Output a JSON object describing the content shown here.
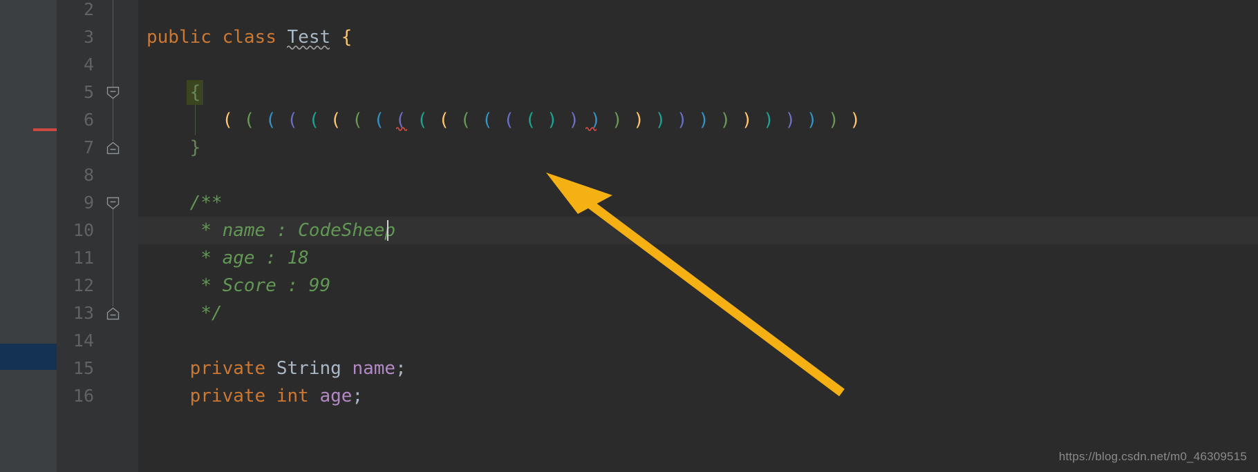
{
  "theme": {
    "editor_bg": "#2b2b2b",
    "gutter_bg": "#313335",
    "panel_bg": "#3c3f41",
    "caret_line_bg": "#323232",
    "line_number_color": "#606366",
    "keyword_color": "#cc7832",
    "comment_color": "#629755",
    "field_color": "#b389c5",
    "identifier_color": "#a9b7c6",
    "brace_yellow": "#ffc66d",
    "brace_green": "#6a8759",
    "error_underline_color": "#cc4a42",
    "warning_underline_color": "#9b9b9b",
    "brace_match_highlight": "#3b4620",
    "arrow_color": "#f5b014"
  },
  "gutter": {
    "line_numbers": [
      "2",
      "3",
      "4",
      "5",
      "6",
      "7",
      "8",
      "9",
      "10",
      "11",
      "12",
      "13",
      "14",
      "15",
      "16"
    ],
    "fold_markers": [
      {
        "line": "5",
        "type": "collapse-minus-icon"
      },
      {
        "line": "7",
        "type": "fold-end-icon"
      },
      {
        "line": "9",
        "type": "collapse-minus-icon"
      },
      {
        "line": "13",
        "type": "fold-end-icon"
      }
    ]
  },
  "editor": {
    "current_line": "10",
    "lines": [
      {
        "num": "2",
        "tokens": []
      },
      {
        "num": "3",
        "tokens": [
          {
            "text": "public",
            "style": "kw"
          },
          {
            "text": " ",
            "style": "plain"
          },
          {
            "text": "class",
            "style": "kw"
          },
          {
            "text": " ",
            "style": "plain"
          },
          {
            "text": "Test",
            "style": "cls"
          },
          {
            "text": " ",
            "style": "plain"
          },
          {
            "text": "{",
            "style": "brace-y"
          }
        ]
      },
      {
        "num": "4",
        "tokens": []
      },
      {
        "num": "5",
        "tokens": [
          {
            "text": "    ",
            "style": "plain"
          },
          {
            "text": "{",
            "style": "brace-g"
          }
        ]
      },
      {
        "num": "6",
        "tokens": []
      },
      {
        "num": "7",
        "tokens": [
          {
            "text": "    ",
            "style": "plain"
          },
          {
            "text": "}",
            "style": "brace-g"
          }
        ]
      },
      {
        "num": "8",
        "tokens": []
      },
      {
        "num": "9",
        "tokens": [
          {
            "text": "    /**",
            "style": "cmt"
          }
        ]
      },
      {
        "num": "10",
        "tokens": [
          {
            "text": "     * name : CodeSheep",
            "style": "cmt"
          }
        ]
      },
      {
        "num": "11",
        "tokens": [
          {
            "text": "     * age : 18",
            "style": "cmt"
          }
        ]
      },
      {
        "num": "12",
        "tokens": [
          {
            "text": "     * Score : 99",
            "style": "cmt"
          }
        ]
      },
      {
        "num": "13",
        "tokens": [
          {
            "text": "     */",
            "style": "cmt"
          }
        ]
      },
      {
        "num": "14",
        "tokens": []
      },
      {
        "num": "15",
        "tokens": [
          {
            "text": "    ",
            "style": "plain"
          },
          {
            "text": "private",
            "style": "kw"
          },
          {
            "text": " ",
            "style": "plain"
          },
          {
            "text": "String",
            "style": "type"
          },
          {
            "text": " ",
            "style": "plain"
          },
          {
            "text": "name",
            "style": "field"
          },
          {
            "text": ";",
            "style": "plain"
          }
        ]
      },
      {
        "num": "16",
        "tokens": [
          {
            "text": "    ",
            "style": "plain"
          },
          {
            "text": "private",
            "style": "kw"
          },
          {
            "text": " ",
            "style": "plain"
          },
          {
            "text": "int",
            "style": "kw"
          },
          {
            "text": " ",
            "style": "plain"
          },
          {
            "text": "age",
            "style": "field"
          },
          {
            "text": ";",
            "style": "plain"
          }
        ]
      }
    ],
    "rainbow_paren_line": {
      "num": "6",
      "text": "( ( ( ( ( ( ( ( ( ( ( ( ( ( ( ) ) ) ) ) ) ) ) ) ) ) ) ) ) )",
      "open_count": 15,
      "close_count": 15,
      "colors": [
        "#ffc66d",
        "#6a9955",
        "#3592c4",
        "#6a70c4",
        "#1da391"
      ],
      "error_marked_paren_index": 14,
      "trailing_error_marked_paren_index": 29
    },
    "warning_underline_token": "Test",
    "caret_after_text": "CodeSheep"
  },
  "annotation": {
    "arrow_name": "pointer-arrow",
    "arrow_color": "#f5b014",
    "points_at": "rainbow-parentheses"
  },
  "watermark": {
    "text": "https://blog.csdn.net/m0_46309515"
  }
}
